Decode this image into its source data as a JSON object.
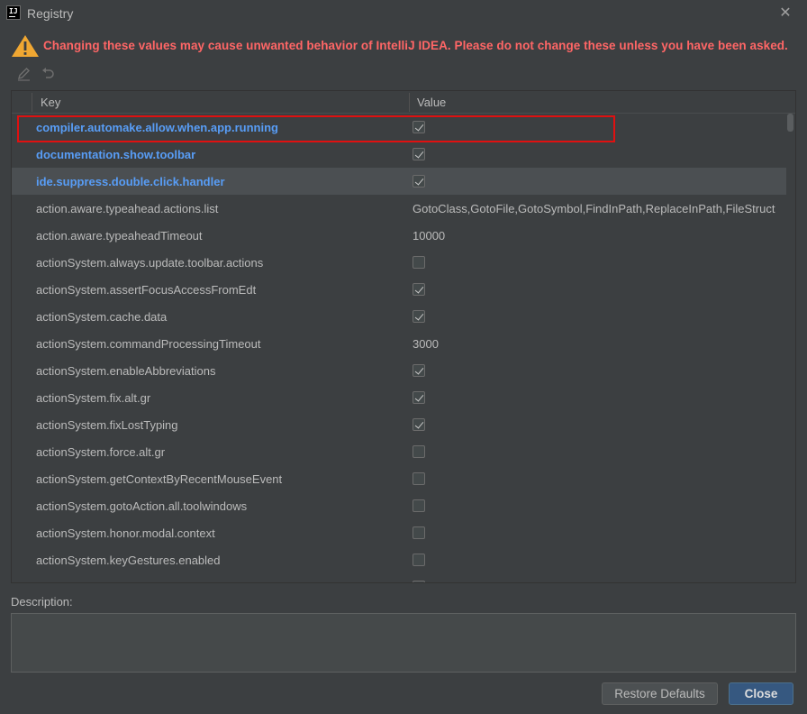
{
  "window": {
    "title": "Registry",
    "icon_text": "IJ",
    "close_glyph": "✕"
  },
  "warning": {
    "text": "Changing these values may cause unwanted behavior of IntelliJ IDEA. Please do not change these unless you have been asked.",
    "color": "#ff6666",
    "icon": "warning-triangle-icon"
  },
  "toolbar": {
    "edit_icon": "pencil-icon",
    "revert_icon": "undo-icon"
  },
  "table": {
    "headers": {
      "key": "Key",
      "value": "Value"
    },
    "rows": [
      {
        "key": "compiler.automake.allow.when.app.running",
        "type": "bool",
        "checked": true,
        "modified": true,
        "selected": false
      },
      {
        "key": "documentation.show.toolbar",
        "type": "bool",
        "checked": true,
        "modified": true,
        "selected": false
      },
      {
        "key": "ide.suppress.double.click.handler",
        "type": "bool",
        "checked": true,
        "modified": true,
        "selected": true
      },
      {
        "key": "action.aware.typeahead.actions.list",
        "type": "text",
        "value": "GotoClass,GotoFile,GotoSymbol,FindInPath,ReplaceInPath,FileStruct",
        "modified": false,
        "selected": false
      },
      {
        "key": "action.aware.typeaheadTimeout",
        "type": "text",
        "value": "10000",
        "modified": false,
        "selected": false
      },
      {
        "key": "actionSystem.always.update.toolbar.actions",
        "type": "bool",
        "checked": false,
        "modified": false,
        "selected": false
      },
      {
        "key": "actionSystem.assertFocusAccessFromEdt",
        "type": "bool",
        "checked": true,
        "modified": false,
        "selected": false
      },
      {
        "key": "actionSystem.cache.data",
        "type": "bool",
        "checked": true,
        "modified": false,
        "selected": false
      },
      {
        "key": "actionSystem.commandProcessingTimeout",
        "type": "text",
        "value": "3000",
        "modified": false,
        "selected": false
      },
      {
        "key": "actionSystem.enableAbbreviations",
        "type": "bool",
        "checked": true,
        "modified": false,
        "selected": false
      },
      {
        "key": "actionSystem.fix.alt.gr",
        "type": "bool",
        "checked": true,
        "modified": false,
        "selected": false
      },
      {
        "key": "actionSystem.fixLostTyping",
        "type": "bool",
        "checked": true,
        "modified": false,
        "selected": false
      },
      {
        "key": "actionSystem.force.alt.gr",
        "type": "bool",
        "checked": false,
        "modified": false,
        "selected": false
      },
      {
        "key": "actionSystem.getContextByRecentMouseEvent",
        "type": "bool",
        "checked": false,
        "modified": false,
        "selected": false
      },
      {
        "key": "actionSystem.gotoAction.all.toolwindows",
        "type": "bool",
        "checked": false,
        "modified": false,
        "selected": false
      },
      {
        "key": "actionSystem.honor.modal.context",
        "type": "bool",
        "checked": false,
        "modified": false,
        "selected": false
      },
      {
        "key": "actionSystem.keyGestures.enabled",
        "type": "bool",
        "checked": false,
        "modified": false,
        "selected": false
      },
      {
        "key": "",
        "type": "bool",
        "checked": false,
        "modified": false,
        "selected": false
      }
    ]
  },
  "description": {
    "label": "Description:",
    "text": ""
  },
  "buttons": {
    "restore": "Restore Defaults",
    "close": "Close"
  },
  "colors": {
    "background": "#3c3f41",
    "modified_key": "#589df6",
    "highlight_box": "#e01010",
    "primary_button": "#365880"
  }
}
